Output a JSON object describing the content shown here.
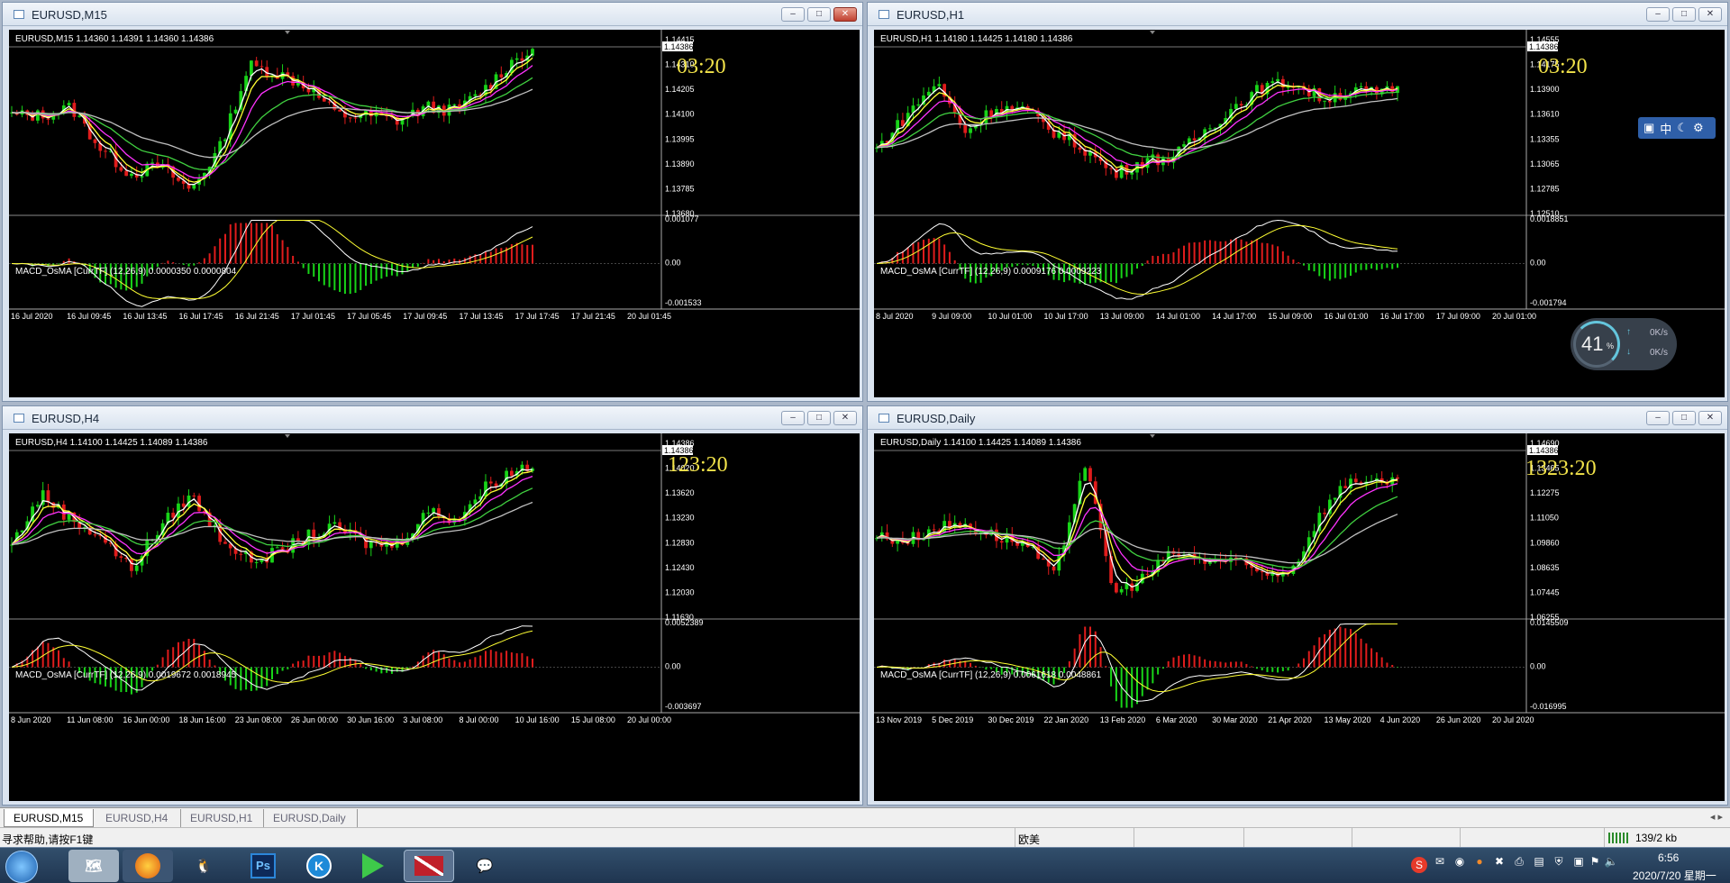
{
  "windows": [
    {
      "id": "m15",
      "title": "EURUSD,M15",
      "info": "EURUSD,M15  1.14360 1.14391 1.14360 1.14386",
      "prices": [
        "1.14415",
        "1.14310",
        "1.14205",
        "1.14100",
        "1.13995",
        "1.13890",
        "1.13785",
        "1.13680"
      ],
      "current_price": "1.14386",
      "sub_info": "MACD_OsMA [CurrTF] (12,26,9) 0.0000350  0.0000804",
      "sub_levels": [
        "0.001077",
        "0.00",
        "-0.001533"
      ],
      "dates": [
        "16 Jul 2020",
        "16 Jul 09:45",
        "16 Jul 13:45",
        "16 Jul 17:45",
        "16 Jul 21:45",
        "17 Jul 01:45",
        "17 Jul 05:45",
        "17 Jul 09:45",
        "17 Jul 13:45",
        "17 Jul 17:45",
        "17 Jul 21:45",
        "20 Jul 01:45"
      ],
      "timer": "03:20"
    },
    {
      "id": "h1",
      "title": "EURUSD,H1",
      "info": "EURUSD,H1  1.14180 1.14425 1.14180 1.14386",
      "prices": [
        "1.14555",
        "1.14175",
        "1.13900",
        "1.13610",
        "1.13355",
        "1.13065",
        "1.12785",
        "1.12510"
      ],
      "current_price": "1.14386",
      "sub_info": "MACD_OsMA [CurrTF] (12,26,9) 0.0009176  0.0009223",
      "sub_levels": [
        "0.0018851",
        "0.00",
        "-0.001794"
      ],
      "dates": [
        "8 Jul 2020",
        "9 Jul 09:00",
        "10 Jul 01:00",
        "10 Jul 17:00",
        "13 Jul 09:00",
        "14 Jul 01:00",
        "14 Jul 17:00",
        "15 Jul 09:00",
        "16 Jul 01:00",
        "16 Jul 17:00",
        "17 Jul 09:00",
        "20 Jul 01:00"
      ],
      "timer": "03:20"
    },
    {
      "id": "h4",
      "title": "EURUSD,H4",
      "info": "EURUSD,H4  1.14100 1.14425 1.14089 1.14386",
      "prices": [
        "1.14386",
        "1.14020",
        "1.13620",
        "1.13230",
        "1.12830",
        "1.12430",
        "1.12030",
        "1.11630"
      ],
      "current_price": "1.14386",
      "sub_info": "MACD_OsMA [CurrTF] (12,26,9) 0.0019672  0.0018945",
      "sub_levels": [
        "0.0052389",
        "0.00",
        "-0.003697"
      ],
      "dates": [
        "8 Jun 2020",
        "11 Jun 08:00",
        "16 Jun 00:00",
        "18 Jun 16:00",
        "23 Jun 08:00",
        "26 Jun 00:00",
        "30 Jun 16:00",
        "3 Jul 08:00",
        "8 Jul 00:00",
        "10 Jul 16:00",
        "15 Jul 08:00",
        "20 Jul 00:00"
      ],
      "timer": "123:20"
    },
    {
      "id": "d1",
      "title": "EURUSD,Daily",
      "info": "EURUSD,Daily  1.14100 1.14425 1.14089 1.14386",
      "prices": [
        "1.14690",
        "1.13465",
        "1.12275",
        "1.11050",
        "1.09860",
        "1.08635",
        "1.07445",
        "1.06255"
      ],
      "current_price": "1.14386",
      "sub_info": "MACD_OsMA [CurrTF] (12,26,9) 0.0061618  0.0048861",
      "sub_levels": [
        "0.0145509",
        "0.00",
        "-0.016995"
      ],
      "dates": [
        "13 Nov 2019",
        "5 Dec 2019",
        "30 Dec 2019",
        "22 Jan 2020",
        "13 Feb 2020",
        "6 Mar 2020",
        "30 Mar 2020",
        "21 Apr 2020",
        "13 May 2020",
        "4 Jun 2020",
        "26 Jun 2020",
        "20 Jul 2020"
      ],
      "timer": "1323:20"
    }
  ],
  "tabs": [
    "EURUSD,M15",
    "EURUSD,H4",
    "EURUSD,H1",
    "EURUSD,Daily"
  ],
  "active_tab": "EURUSD,M15",
  "status": {
    "help": "寻求帮助,请按F1键",
    "profile": "欧美",
    "traffic": "139/2 kb"
  },
  "speed_widget": {
    "percent": "41",
    "unit": "%",
    "up": "0K/s",
    "down": "0K/s"
  },
  "ime_toolbar": {
    "label": "中"
  },
  "clock": {
    "time": "6:56",
    "date": "2020/7/20 星期一"
  },
  "taskbar_apps": [
    "start-orb",
    "maps-app",
    "firefox",
    "qq",
    "photoshop",
    "kugou",
    "media-player",
    "mt4-terminal",
    "wechat"
  ],
  "colors": {
    "bull": "#18d418",
    "bear": "#e01c1c",
    "ma_white": "#ffffff",
    "ma_yellow": "#ffff33",
    "ma_magenta": "#ff33ff",
    "ma_green": "#40d040",
    "ma_gray": "#c0c0c0",
    "timer": "#f2e34a"
  }
}
